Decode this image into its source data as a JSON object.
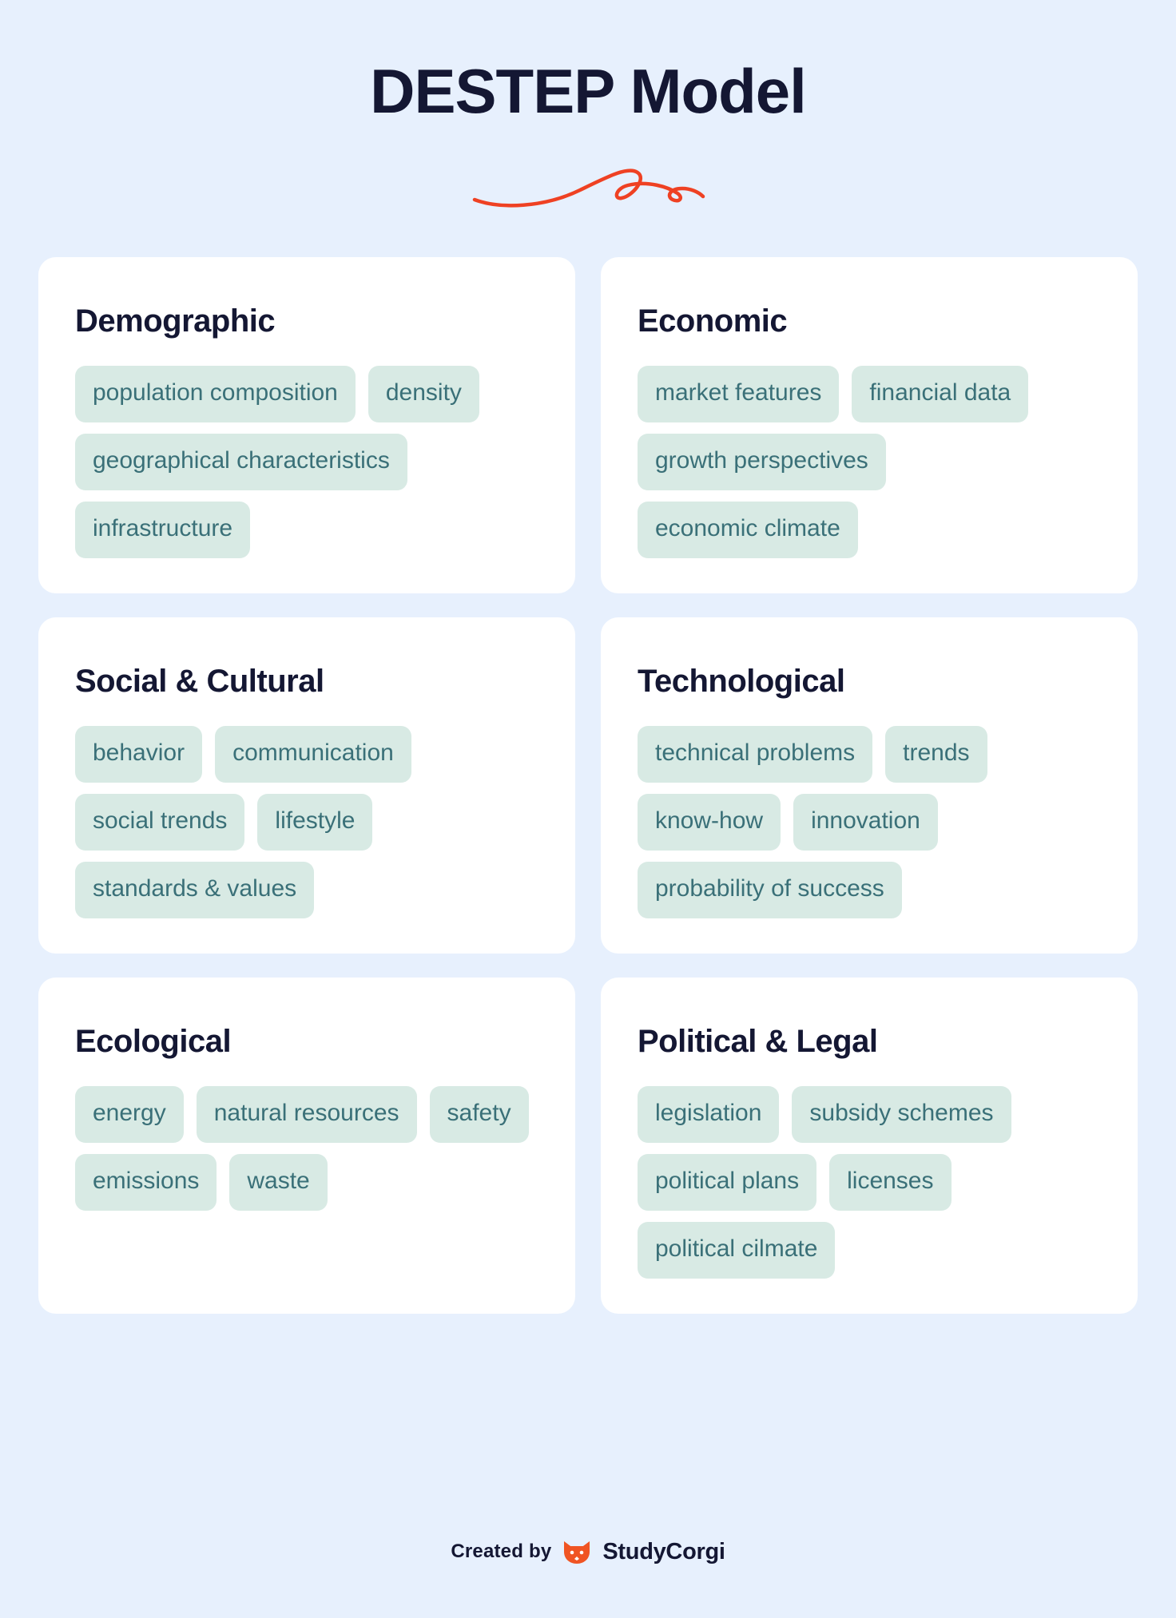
{
  "page": {
    "title": "DESTEP Model",
    "background_color": "#e7f0fd",
    "card_color": "#ffffff",
    "heading_color": "#141733",
    "tag_bg_color": "#d8eae4",
    "tag_text_color": "#3a7078",
    "accent_color": "#ef4123"
  },
  "divider": {
    "icon": "squiggle-flourish",
    "color": "#ef4123"
  },
  "cards": [
    {
      "title": "Demographic",
      "tags": [
        "population composition",
        "density",
        "geographical characteristics",
        "infrastructure"
      ]
    },
    {
      "title": "Economic",
      "tags": [
        "market features",
        "financial data",
        "growth perspectives",
        "economic climate"
      ]
    },
    {
      "title": "Social & Cultural",
      "tags": [
        "behavior",
        "communication",
        "social trends",
        "lifestyle",
        "standards & values"
      ]
    },
    {
      "title": "Technological",
      "tags": [
        "technical problems",
        "trends",
        "know-how",
        "innovation",
        "probability of success"
      ]
    },
    {
      "title": "Ecological",
      "tags": [
        "energy",
        "natural resources",
        "safety",
        "emissions",
        "waste"
      ]
    },
    {
      "title": "Political & Legal",
      "tags": [
        "legislation",
        "subsidy schemes",
        "political plans",
        "licenses",
        "political cilmate"
      ]
    }
  ],
  "footer": {
    "created_by": "Created by",
    "brand": "StudyCorgi",
    "logo_icon": "corgi-logo-icon"
  }
}
